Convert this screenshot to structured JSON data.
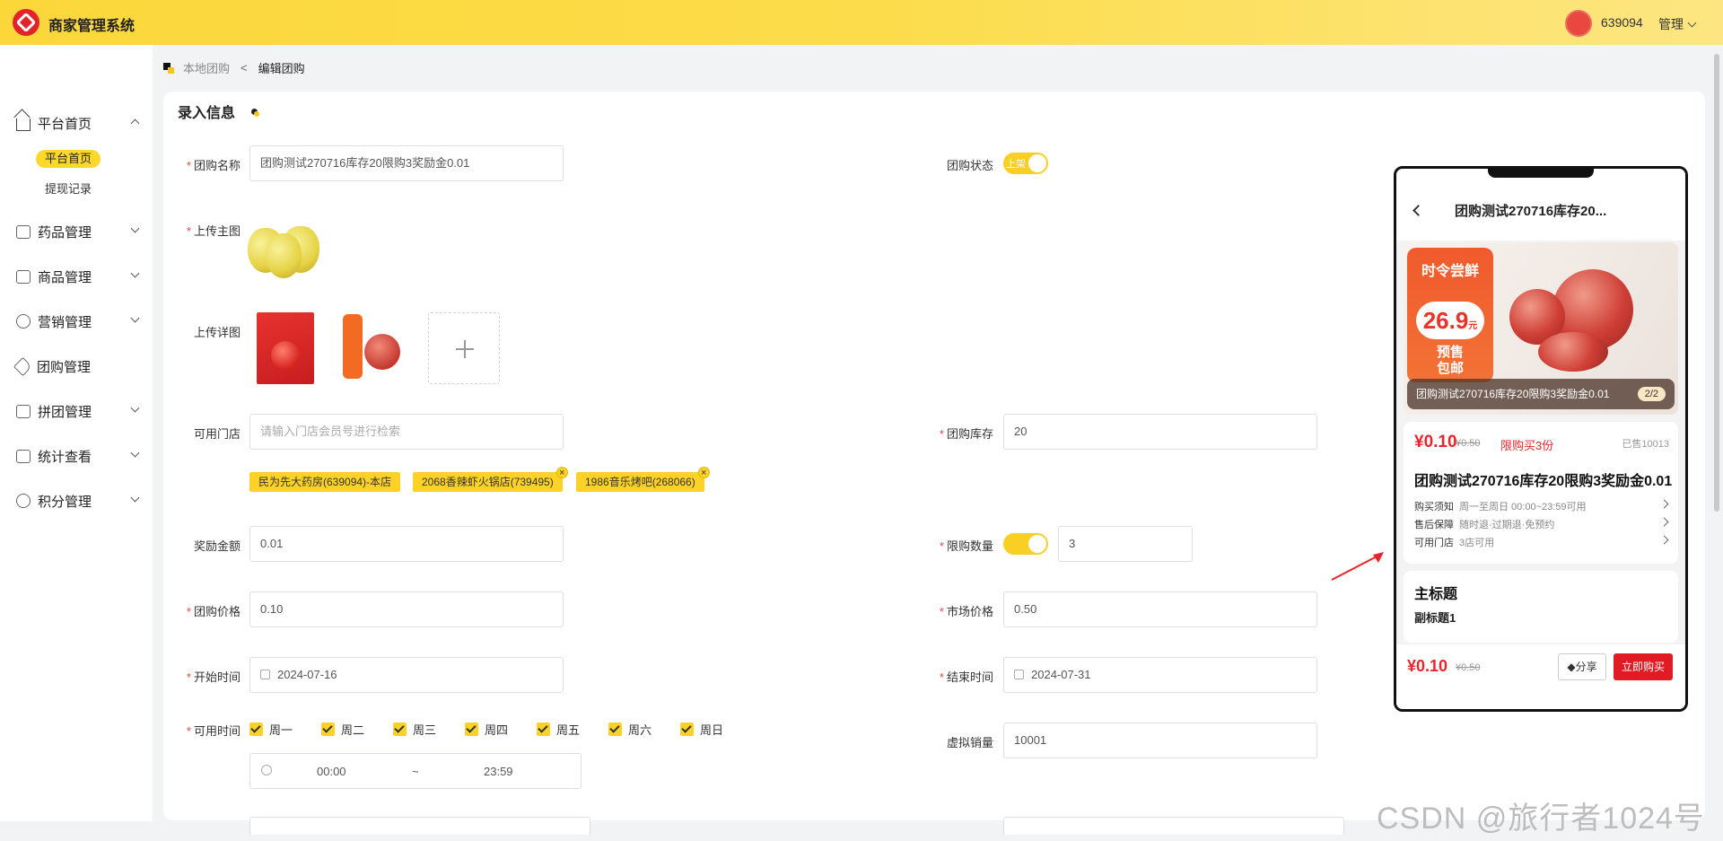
{
  "app": {
    "title": "商家管理系统",
    "user_id": "639094",
    "menu_label": "管理"
  },
  "sidebar": {
    "items": [
      {
        "label": "平台首页",
        "icon": "home-icon"
      },
      {
        "label": "药品管理",
        "icon": "medicine-box-icon"
      },
      {
        "label": "商品管理",
        "icon": "goods-icon"
      },
      {
        "label": "营销管理",
        "icon": "marketing-icon"
      },
      {
        "label": "团购管理",
        "icon": "tag-icon"
      },
      {
        "label": "拼团管理",
        "icon": "group-icon"
      },
      {
        "label": "统计查看",
        "icon": "chart-icon"
      },
      {
        "label": "积分管理",
        "icon": "points-icon"
      }
    ],
    "sub_items": {
      "active": "平台首页",
      "second": "提现记录"
    }
  },
  "breadcrumb": {
    "parent": "本地团购",
    "current": "编辑团购"
  },
  "form": {
    "section_title": "录入信息",
    "name": {
      "label": "团购名称",
      "value": "团购测试270716库存20限购3奖励金0.01"
    },
    "status": {
      "label": "团购状态",
      "toggle_text": "上架"
    },
    "main_image": {
      "label": "上传主图"
    },
    "detail_image": {
      "label": "上传详图"
    },
    "stores": {
      "label": "可用门店",
      "placeholder": "请输入门店会员号进行检索",
      "chips": [
        "民为先大药房(639094)-本店",
        "2068香辣虾火锅店(739495)",
        "1986音乐烤吧(268066)"
      ]
    },
    "stock": {
      "label": "团购库存",
      "value": "20"
    },
    "reward": {
      "label": "奖励金额",
      "value": "0.01"
    },
    "limit": {
      "label": "限购数量",
      "value": "3"
    },
    "price": {
      "label": "团购价格",
      "value": "0.10"
    },
    "market_price": {
      "label": "市场价格",
      "value": "0.50"
    },
    "start_time": {
      "label": "开始时间",
      "value": "2024-07-16"
    },
    "end_time": {
      "label": "结束时间",
      "value": "2024-07-31"
    },
    "available_time": {
      "label": "可用时间",
      "days": [
        "周一",
        "周二",
        "周三",
        "周四",
        "周五",
        "周六",
        "周日"
      ],
      "from": "00:00",
      "sep": "~",
      "to": "23:59"
    },
    "virtual_sales": {
      "label": "虚拟销量",
      "value": "10001"
    }
  },
  "preview": {
    "title": "团购测试270716库存20...",
    "banner_tag": "时令尝鲜",
    "banner_price": "26.9",
    "banner_unit": "元",
    "banner_line1": "预售",
    "banner_line2": "包邮",
    "caption": "团购测试270716库存20限购3奖励金0.01",
    "page_badge": "2/2",
    "price": "¥0.10",
    "old_price": "¥0.50",
    "limit_text": "限购买3份",
    "sold_text": "已售10013",
    "product_name": "团购测试270716库存20限购3奖励金0.01",
    "rows": [
      {
        "label": "购买须知",
        "value": "周一至周日 00:00~23:59可用"
      },
      {
        "label": "售后保障",
        "value": "随时退·过期退·免预约"
      },
      {
        "label": "可用门店",
        "value": "3店可用"
      }
    ],
    "heading": "主标题",
    "subheading": "副标题1",
    "share_label": "分享",
    "buy_label": "立即购买"
  },
  "watermark": "CSDN @旅行者1024号",
  "colors": {
    "accent": "#fcd227",
    "danger": "#e8252b",
    "topbar": "#fbd73a"
  }
}
